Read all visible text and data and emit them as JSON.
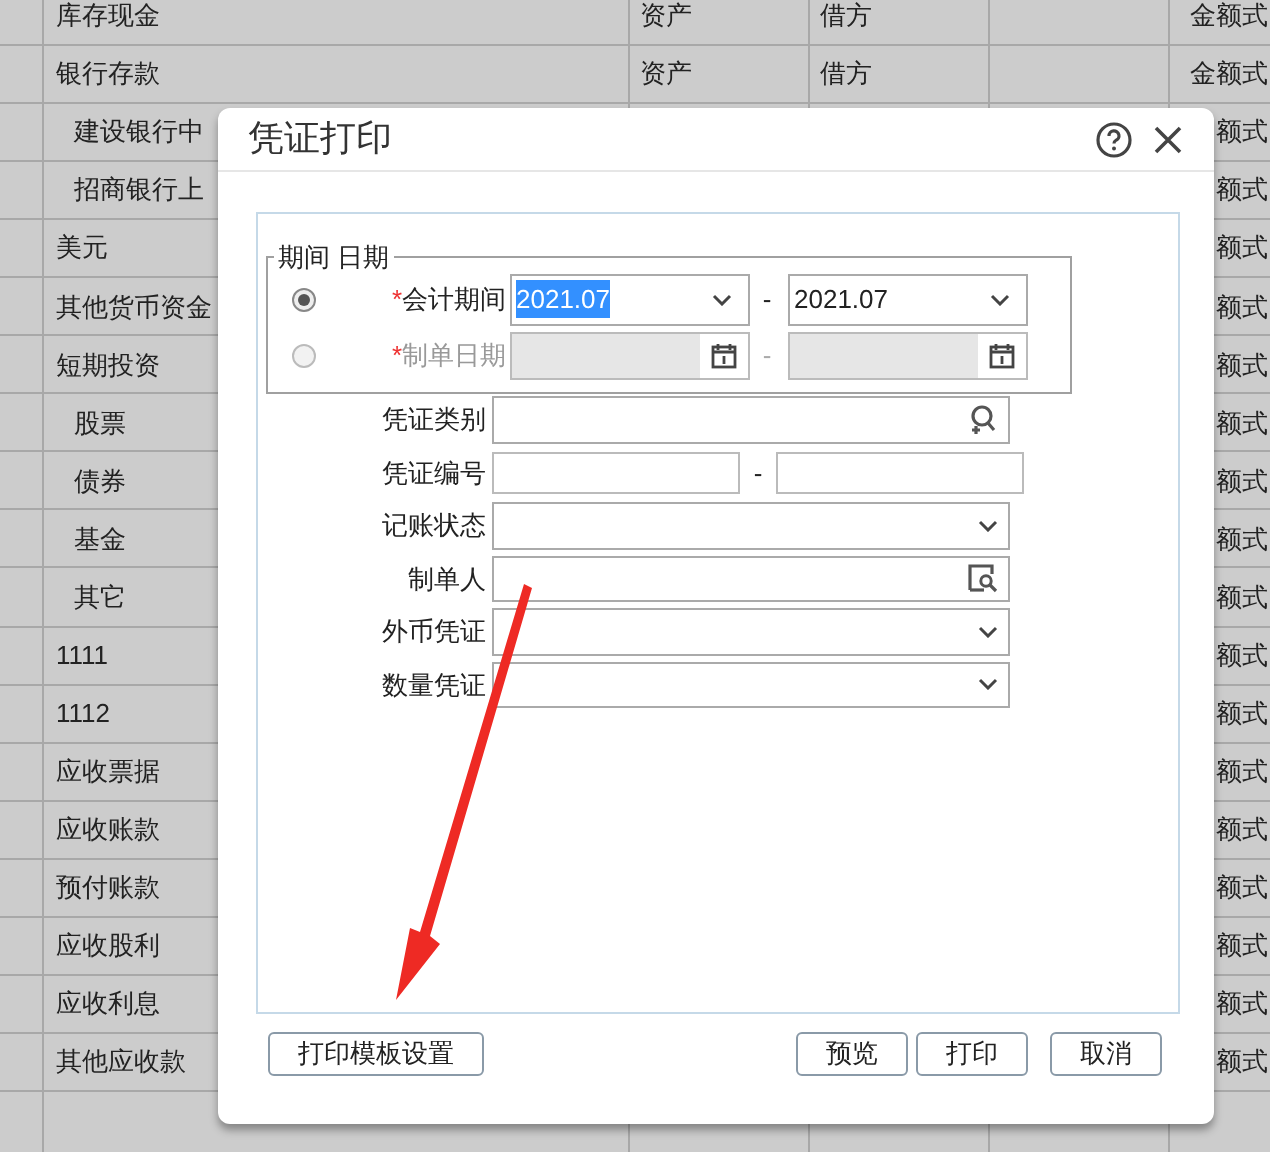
{
  "background_table": {
    "rows": [
      {
        "name": "库存现金",
        "type": "资产",
        "direction": "借方",
        "format": "金额式"
      },
      {
        "name": "银行存款",
        "type": "资产",
        "direction": "借方",
        "format": "金额式",
        "children": [
          {
            "name": "建设银行中",
            "format": "额式"
          },
          {
            "name": "招商银行上",
            "format": "额式"
          }
        ]
      },
      {
        "name": "美元",
        "format": "额式"
      },
      {
        "name": "其他货币资金",
        "format": "额式"
      },
      {
        "name": "短期投资",
        "format": "额式",
        "children": [
          {
            "name": "股票",
            "format": "额式"
          },
          {
            "name": "债券",
            "format": "额式"
          },
          {
            "name": "基金",
            "format": "额式"
          },
          {
            "name": "其它",
            "format": "额式"
          }
        ]
      },
      {
        "name": "1111",
        "format": "额式"
      },
      {
        "name": "1112",
        "format": "额式"
      },
      {
        "name": "应收票据",
        "format": "额式"
      },
      {
        "name": "应收账款",
        "format": "额式"
      },
      {
        "name": "预付账款",
        "format": "额式"
      },
      {
        "name": "应收股利",
        "format": "额式"
      },
      {
        "name": "应收利息",
        "format": "额式"
      },
      {
        "name": "其他应收款",
        "format": "额式"
      }
    ]
  },
  "dialog": {
    "title": "凭证打印",
    "period_group": {
      "legend": "期间 日期",
      "options": [
        {
          "kind": "period",
          "selected": true,
          "disabled": false,
          "required_mark": "*",
          "label": "会计期间",
          "from": "2021.07",
          "from_highlighted": true,
          "separator": "-",
          "to": "2021.07"
        },
        {
          "kind": "date",
          "selected": false,
          "disabled": true,
          "required_mark": "*",
          "label": "制单日期",
          "separator": "-"
        }
      ]
    },
    "fields": [
      {
        "kind": "lookup",
        "label": "凭证类别"
      },
      {
        "kind": "range",
        "label": "凭证编号",
        "separator": "-"
      },
      {
        "kind": "select",
        "label": "记账状态"
      },
      {
        "kind": "person",
        "label": "制单人"
      },
      {
        "kind": "select",
        "label": "外币凭证"
      },
      {
        "kind": "select",
        "label": "数量凭证"
      }
    ],
    "left_buttons": [
      "打印模板设置"
    ],
    "right_buttons": [
      "预览",
      "打印",
      "取消"
    ]
  }
}
